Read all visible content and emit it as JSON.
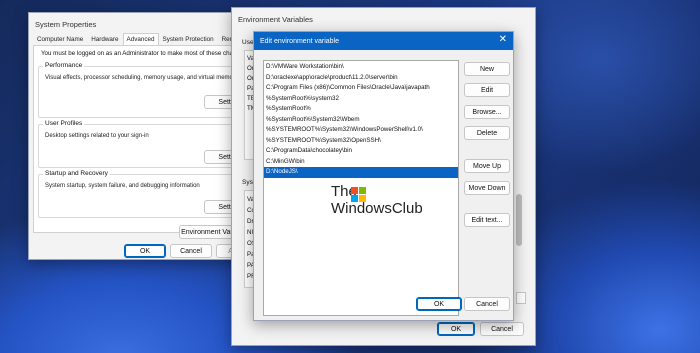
{
  "system_properties": {
    "title": "System Properties",
    "tabs": [
      "Computer Name",
      "Hardware",
      "Advanced",
      "System Protection",
      "Remote"
    ],
    "active_tab": "Advanced",
    "admin_note": "You must be logged on as an Administrator to make most of these changes",
    "performance": {
      "title": "Performance",
      "desc": "Visual effects, processor scheduling, memory usage, and virtual memory",
      "button": "Settings..."
    },
    "user_profiles": {
      "title": "User Profiles",
      "desc": "Desktop settings related to your sign-in",
      "button": "Settings..."
    },
    "startup": {
      "title": "Startup and Recovery",
      "desc": "System startup, system failure, and debugging information",
      "button": "Settings..."
    },
    "env_button": "Environment Variables...",
    "ok": "OK",
    "cancel": "Cancel",
    "apply": "Apply"
  },
  "environment_variables": {
    "title": "Environment Variables",
    "user_section_fragment": "User",
    "system_section_fragment": "Syste",
    "user_row_fragments": [
      "Va",
      "On",
      "On",
      "Pa",
      "TE",
      "TM"
    ],
    "system_row_fragments": [
      "Va",
      "Co",
      "Dri",
      "NU",
      "OS",
      "Pa",
      "PA",
      "PR"
    ],
    "ok": "OK",
    "cancel": "Cancel"
  },
  "edit_env": {
    "title": "Edit environment variable",
    "paths": [
      "D:\\VMWare Workstation\\bin\\",
      "D:\\oraclexe\\app\\oracle\\product\\11.2.0\\server\\bin",
      "C:\\Program Files (x86)\\Common Files\\Oracle\\Java\\javapath",
      "%SystemRoot%\\system32",
      "%SystemRoot%",
      "%SystemRoot%\\System32\\Wbem",
      "%SYSTEMROOT%\\System32\\WindowsPowerShell\\v1.0\\",
      "%SYSTEMROOT%\\System32\\OpenSSH\\",
      "C:\\ProgramData\\chocolatey\\bin",
      "C:\\MinGW\\bin",
      "D:\\NodeJS\\"
    ],
    "selected_index": 10,
    "buttons": {
      "new": "New",
      "edit": "Edit",
      "browse": "Browse...",
      "delete": "Delete",
      "move_up": "Move Up",
      "move_down": "Move Down",
      "edit_text": "Edit text...",
      "ok": "OK",
      "cancel": "Cancel"
    }
  },
  "watermark": {
    "line1": "The",
    "line2": "WindowsClub"
  },
  "colors": {
    "accent": "#0a64c4",
    "selection": "#0a64c4"
  }
}
